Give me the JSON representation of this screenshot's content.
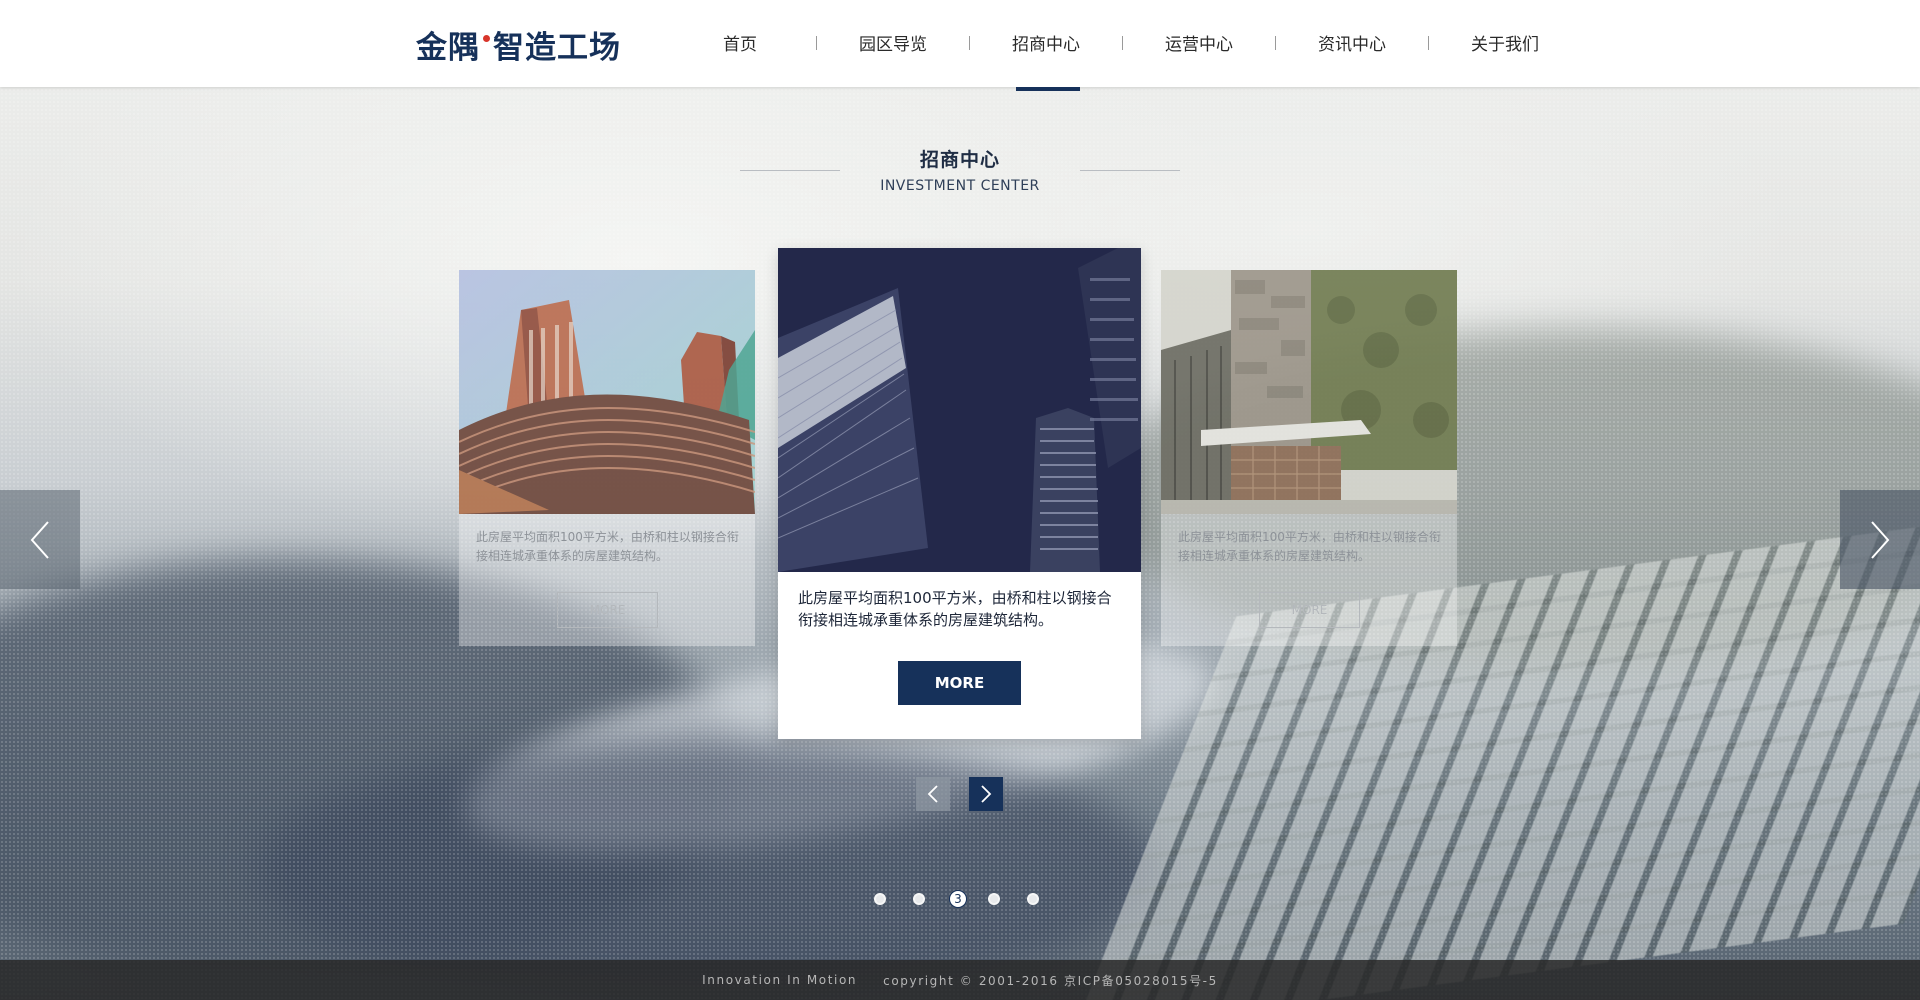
{
  "brand": {
    "part1": "金隅",
    "part2": "智造工场",
    "dot_color": "#d8352b",
    "color": "#16315a"
  },
  "nav": {
    "items": [
      {
        "label": "首页"
      },
      {
        "label": "园区导览"
      },
      {
        "label": "招商中心",
        "active": true
      },
      {
        "label": "运营中心"
      },
      {
        "label": "资讯中心"
      },
      {
        "label": "关于我们"
      }
    ]
  },
  "section": {
    "title": "招商中心",
    "subtitle": "INVESTMENT CENTER"
  },
  "cards": {
    "left": {
      "description": "此房屋平均面积100平方米，由桥和柱以钢接合衔接相连城承重体系的房屋建筑结构。",
      "more_label": "MORE"
    },
    "center": {
      "description": "此房屋平均面积100平方米，由桥和柱以钢接合衔接相连城承重体系的房屋建筑结构。",
      "more_label": "MORE"
    },
    "right": {
      "description": "此房屋平均面积100平方米，由桥和柱以钢接合衔接相连城承重体系的房屋建筑结构。",
      "more_label": "MORE"
    }
  },
  "pagination": {
    "current": "3",
    "total": 5
  },
  "footer": {
    "slogan": "Innovation In Motion",
    "copyright": "copyright © 2001-2016 京ICP备05028015号-5"
  },
  "colors": {
    "accent": "#16315a",
    "footer_bg": "#282828"
  }
}
